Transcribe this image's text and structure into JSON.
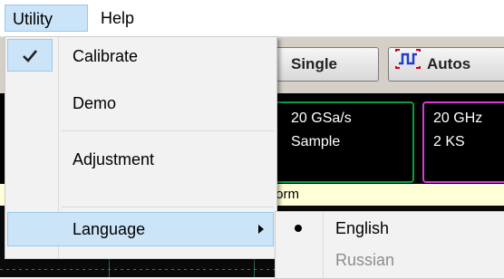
{
  "menubar": {
    "items": [
      {
        "label": "Utility"
      },
      {
        "label": "Help"
      }
    ]
  },
  "toolbar": {
    "single_label": "Single",
    "auto_label": "Autos"
  },
  "status": {
    "sample_rate_fragment": "z",
    "sample_rate": "20 GSa/s",
    "acquisition_mode": "Sample",
    "bandwidth": "20 GHz",
    "memory_depth": "2 KS",
    "waveform_fragment": "form"
  },
  "utility_menu": {
    "items": [
      {
        "label": "Calibrate",
        "checked": true
      },
      {
        "label": "Demo"
      },
      {
        "label": "Adjustment"
      },
      {
        "label": "Language",
        "has_submenu": true
      }
    ]
  },
  "language_submenu": {
    "items": [
      {
        "label": "English",
        "selected": true
      },
      {
        "label": "Russian",
        "enabled": false
      }
    ]
  },
  "colors": {
    "menu_highlight": "#cce4f7",
    "highlight_border": "#99c9ef",
    "sample_panel_border": "#0b9c3c",
    "memory_panel_border": "#d63ad8",
    "waveform_strip": "#ffffd8"
  },
  "icons": {
    "check": "checkmark-icon",
    "submenu": "submenu-arrow-icon",
    "radio": "radio-bullet-icon",
    "autoscale": "autoscale-icon"
  }
}
